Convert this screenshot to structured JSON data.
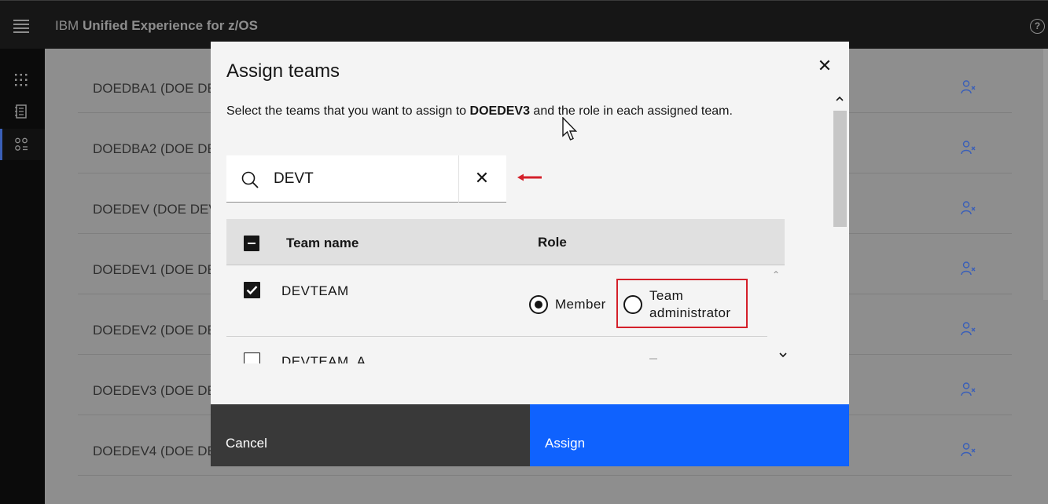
{
  "header": {
    "brand": "IBM",
    "title": "Unified Experience for z/OS",
    "help_icon": "help-icon"
  },
  "rail": {
    "items": [
      {
        "icon": "apps-grid-icon",
        "active": false
      },
      {
        "icon": "notebook-icon",
        "active": false
      },
      {
        "icon": "user-groups-icon",
        "active": true
      }
    ]
  },
  "background_list": {
    "rows": [
      {
        "label": "DOEDBA1 (DOE DE",
        "icon": "user-remove-icon"
      },
      {
        "label": "DOEDBA2 (DOE DE",
        "icon": "user-remove-icon"
      },
      {
        "label": "DOEDEV (DOE DEV",
        "icon": "user-remove-icon"
      },
      {
        "label": "DOEDEV1 (DOE DE",
        "icon": "user-remove-icon"
      },
      {
        "label": "DOEDEV2 (DOE DE",
        "icon": "user-remove-icon"
      },
      {
        "label": "DOEDEV3 (DOE DE",
        "icon": "user-remove-icon"
      },
      {
        "label": "DOEDEV4 (DOE DE",
        "icon": "user-remove-icon"
      }
    ]
  },
  "modal": {
    "title": "Assign teams",
    "close_icon": "close-icon",
    "desc_before": "Select the teams that you want to assign to ",
    "desc_user": "DOEDEV3",
    "desc_after": " and the role in each assigned team.",
    "search": {
      "value": "DEVT",
      "icon": "search-icon",
      "clear_icon": "clear-icon"
    },
    "table": {
      "header_name": "Team name",
      "header_role": "Role",
      "rows": [
        {
          "name": "DEVTEAM",
          "checked": true,
          "role_member": "Member",
          "role_admin_line1": "Team",
          "role_admin_line2": "administrator",
          "selected_role": "Member"
        },
        {
          "name": "DEVTEAM_A",
          "checked": false
        }
      ]
    },
    "footer": {
      "cancel_label": "Cancel",
      "assign_label": "Assign"
    }
  },
  "colors": {
    "primary": "#0f62fe",
    "secondary": "#393939",
    "highlight": "#d4202a",
    "header_bg": "#161616"
  }
}
